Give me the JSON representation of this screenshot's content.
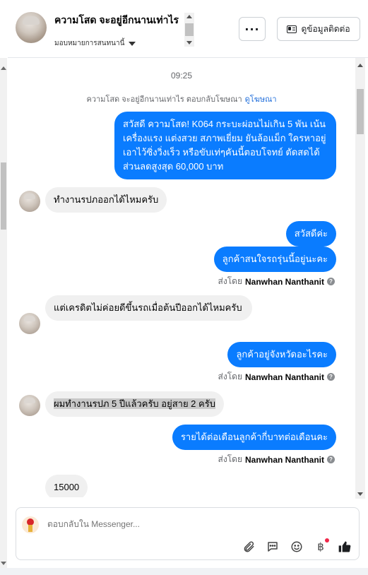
{
  "header": {
    "contact_name": "ความโสด จะอยู่อีกนานเท่าไร",
    "assign_label": "มอบหมายการสนทนานี้",
    "more_label": "···",
    "view_contact_label": "ดูข้อมูลติดต่อ"
  },
  "conversation": {
    "timestamp": "09:25",
    "ad_reply_text": "ความโสด จะอยู่อีกนานเท่าไร ตอบกลับโฆษณา",
    "ad_link_label": "ดูโฆษณา",
    "messages": [
      {
        "direction": "outgoing",
        "text": "สวัสดี ความโสด! K064 กระบะผ่อนไม่เกิน 5 พัน เน้นเครื่องแรง แต่งสวย สภาพเยี่ยม ยันล้อแม็ก ใครหาอยู่เอาไว้ซิ่งวิ่งเร็ว หรือขับเท่ๆคันนี้ตอบโจทย์ ตัดสดได้ส่วนลดสูงสุด 60,000 บาท"
      },
      {
        "direction": "incoming",
        "text": "ทำงานรปภออกได้ไหมครับ"
      },
      {
        "direction": "outgoing",
        "text": "สวัสดีค่ะ"
      },
      {
        "direction": "outgoing",
        "text": "ลูกค้าสนใจรถรุ่นนี้อยู่นะคะ"
      },
      {
        "direction": "incoming",
        "text": "แต่เครดิตไม่ค่อยดีขึ้นรถเมื่อต้นปีออกได้ไหมครับ"
      },
      {
        "direction": "outgoing",
        "text": "ลูกค้าอยู่จังหวัดอะไรคะ"
      },
      {
        "direction": "incoming",
        "text": "ผมทำงานรปภ 5 ปีแล้วครับ อยู่สาย 2 ครับ"
      },
      {
        "direction": "outgoing",
        "text": "รายได้ต่อเดือนลูกค้ากี่บาทต่อเดือนคะ"
      },
      {
        "direction": "incoming",
        "text": "15000"
      }
    ],
    "sent_by_prefix": "ส่งโดย",
    "sent_by_name": "Nanwhan Nanthanit",
    "help_glyph": "?"
  },
  "composer": {
    "placeholder": "ตอบกลับใน Messenger...",
    "currency_glyph": "฿"
  },
  "colors": {
    "outgoing_bubble": "#0a7cff",
    "incoming_bubble": "#f0f0f0",
    "link": "#216fdb"
  }
}
